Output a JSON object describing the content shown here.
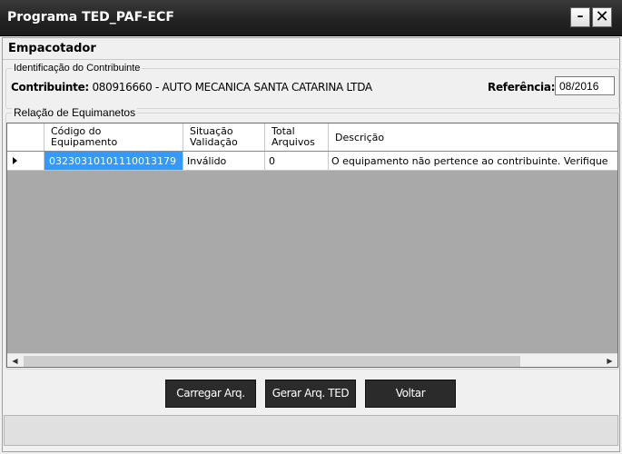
{
  "window": {
    "title": "Programa TED_PAF-ECF",
    "minimize_label": "–",
    "close_label": "✕"
  },
  "page": {
    "heading": "Empacotador"
  },
  "identification": {
    "legend": "Identificação do Contribuinte",
    "contributor_label": "Contribuinte:",
    "contributor_value": "080916660 - AUTO MECANICA SANTA CATARINA LTDA",
    "reference_label": "Referência:",
    "reference_value": "08/2016"
  },
  "equipment": {
    "legend": "Relação de Equimanetos",
    "columns": {
      "code": "Código do Equipamento",
      "status": "Situação Validação",
      "total": "Total Arquivos",
      "description": "Descrição"
    },
    "rows": [
      {
        "code": "03230310101110013179",
        "status": "Inválido",
        "total": "0",
        "description": "O equipamento não pertence ao contribuinte. Verifique"
      }
    ]
  },
  "buttons": {
    "load": "Carregar Arq.",
    "generate": "Gerar Arq. TED",
    "back": "Voltar"
  },
  "icons": {
    "row_selector": "row-arrow-icon",
    "scroll_left": "◀",
    "scroll_right": "▶"
  },
  "colors": {
    "selection": "#3399ff",
    "titlebar": "#222222",
    "button": "#2b2b2b",
    "grid_background": "#a9a9a9"
  }
}
